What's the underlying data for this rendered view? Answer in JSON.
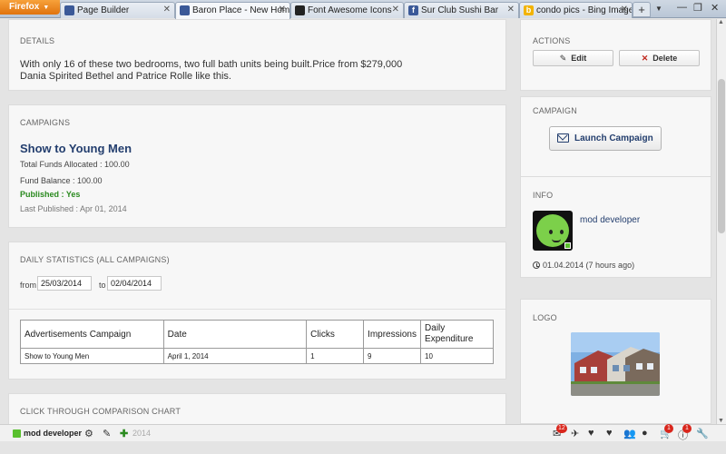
{
  "browser": {
    "menu_label": "Firefox",
    "tabs": [
      {
        "label": "Page Builder",
        "color": "#3b5998"
      },
      {
        "label": "Baron Place - New Home",
        "color": "#3b5998"
      },
      {
        "label": "Font Awesome Icons",
        "color": "#222222"
      },
      {
        "label": "Sur Club Sushi Bar",
        "color": "#3b5998"
      },
      {
        "label": "condo pics - Bing Images",
        "color": "#f2b300"
      }
    ],
    "new_tab_label": "+"
  },
  "details": {
    "title": "DETAILS",
    "line1": "With only 16 of these two bedrooms, two full bath units being built.Price from $279,000",
    "line2": "Dania Spirited Bethel and Patrice Rolle like this."
  },
  "campaigns": {
    "title": "CAMPAIGNS",
    "name": "Show to Young Men",
    "funds": "Total Funds Allocated : 100.00",
    "balance": "Fund Balance : 100.00",
    "status": "Published : Yes",
    "last_published": "Last Published : Apr 01, 2014"
  },
  "daily": {
    "title": "DAILY STATISTICS (ALL CAMPAIGNS)",
    "from_label": "from",
    "from_value": "25/03/2014",
    "to_label": "to",
    "to_value": "02/04/2014",
    "table": {
      "headers": [
        "Advertisements Campaign",
        "Date",
        "Clicks",
        "Impressions",
        "Daily Expenditure"
      ],
      "rows": [
        [
          "Show to Young Men",
          "April 1, 2014",
          "1",
          "9",
          "10"
        ]
      ]
    }
  },
  "chart_section": {
    "title": "CLICK THROUGH COMPARISON CHART"
  },
  "actions": {
    "title": "ACTIONS",
    "edit": "Edit",
    "delete": "Delete"
  },
  "campaign_side": {
    "title": "CAMPAIGN",
    "launch": "Launch Campaign"
  },
  "info": {
    "title": "INFO",
    "user": "mod developer",
    "time": "01.04.2014 (7 hours ago)"
  },
  "logo": {
    "title": "LOGO"
  },
  "bottombar": {
    "user": "mod developer",
    "ghost_text": "2014",
    "badges": {
      "messages": "12",
      "cart": "1",
      "alerts": "1"
    }
  }
}
